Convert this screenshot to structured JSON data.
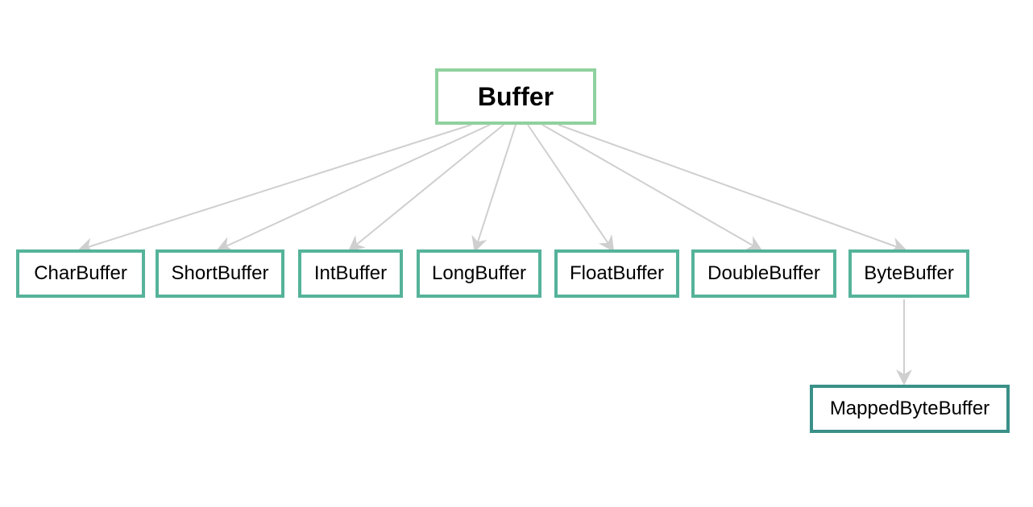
{
  "chart_data": {
    "type": "hierarchy",
    "title": "",
    "root": {
      "name": "Buffer",
      "children": [
        {
          "name": "CharBuffer"
        },
        {
          "name": "ShortBuffer"
        },
        {
          "name": "IntBuffer"
        },
        {
          "name": "LongBuffer"
        },
        {
          "name": "FloatBuffer"
        },
        {
          "name": "DoubleBuffer"
        },
        {
          "name": "ByteBuffer",
          "children": [
            {
              "name": "MappedByteBuffer"
            }
          ]
        }
      ]
    }
  },
  "nodes": {
    "root": "Buffer",
    "char": "CharBuffer",
    "short": "ShortBuffer",
    "int": "IntBuffer",
    "long": "LongBuffer",
    "float": "FloatBuffer",
    "double": "DoubleBuffer",
    "byte": "ByteBuffer",
    "mapped": "MappedByteBuffer"
  },
  "colors": {
    "rootBorder": "#8fd19e",
    "midBorder": "#55b39a",
    "leafBorder": "#3a9088",
    "arrow": "#cfcfcf"
  }
}
